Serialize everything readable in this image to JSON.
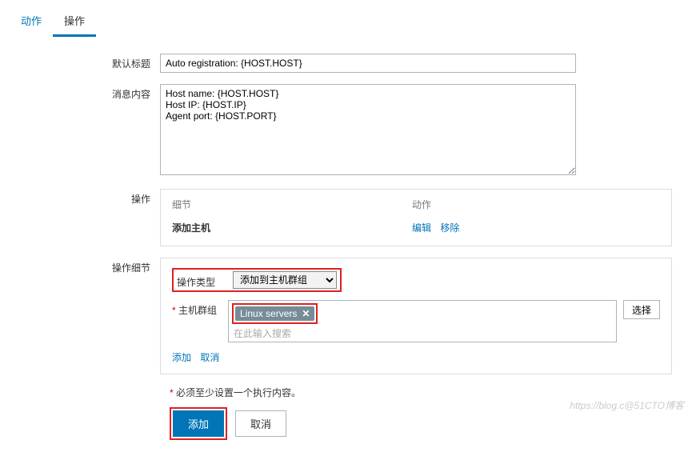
{
  "tabs": {
    "tab1": "动作",
    "tab2": "操作"
  },
  "form": {
    "default_title_label": "默认标题",
    "default_title_value": "Auto registration: {HOST.HOST}",
    "message_label": "消息内容",
    "message_value": "Host name: {HOST.HOST}\nHost IP: {HOST.IP}\nAgent port: {HOST.PORT}",
    "operations_label": "操作",
    "op_detail_label": "操作细节"
  },
  "operations": {
    "header_detail": "细节",
    "header_action": "动作",
    "row_detail": "添加主机",
    "edit_link": "编辑",
    "remove_link": "移除"
  },
  "detail": {
    "type_label": "操作类型",
    "type_value": "添加到主机群组",
    "hostgroup_label": "主机群组",
    "tag_value": "Linux servers",
    "search_placeholder": "在此输入搜索",
    "select_btn": "选择",
    "add_link": "添加",
    "cancel_link": "取消"
  },
  "footer": {
    "note": "必须至少设置一个执行内容。",
    "add_btn": "添加",
    "cancel_btn": "取消"
  },
  "watermark": "https://blog.c@51CTO博客"
}
